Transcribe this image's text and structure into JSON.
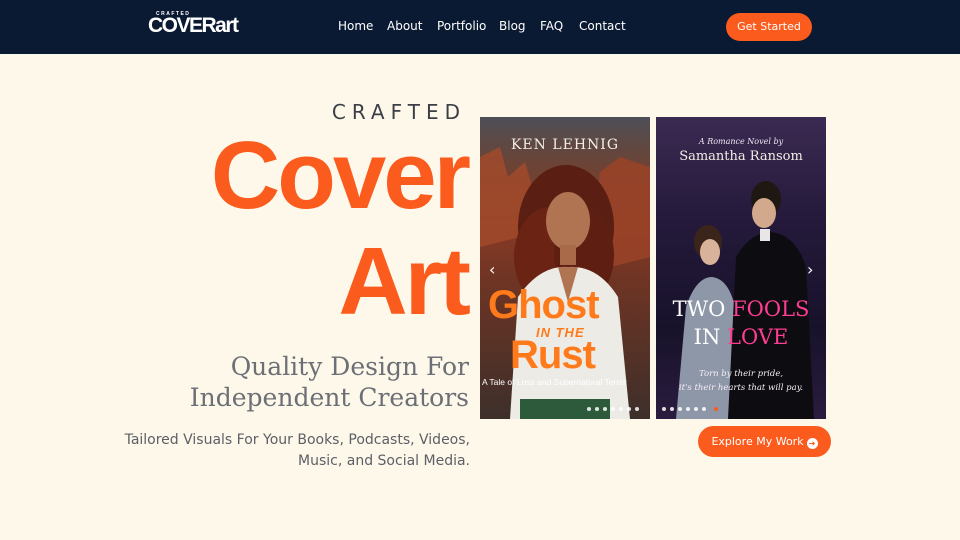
{
  "header": {
    "logo_small": "CRAFTED",
    "logo_big": "COVERart",
    "nav": [
      "Home",
      "About",
      "Portfolio",
      "Blog",
      "FAQ",
      "Contact"
    ],
    "cta": "Get Started"
  },
  "hero": {
    "kicker": "CRAFTED",
    "title_line1": "Cover",
    "title_line2": "Art",
    "tagline_line1": "Quality Design For",
    "tagline_line2": "Independent Creators",
    "subtitle_line1": "Tailored Visuals For Your Books, Podcasts, Videos,",
    "subtitle_line2": "Music, and Social Media.",
    "cta": "Explore My Work",
    "cta_icon": "arrow-right-circle-icon"
  },
  "carousel": {
    "books": [
      {
        "author": "KEN LEHNIG",
        "title_a": "Ghost",
        "title_b": "IN THE",
        "title_c": "Rust",
        "subtitle": "A Tale of Loss and Supernatural Terror"
      },
      {
        "kicker": "A Romance Novel by",
        "author": "Samantha Ransom",
        "title_a": "TWO",
        "title_b": "FOOLS",
        "title_c": "IN",
        "title_d": "LOVE",
        "quote_line1": "Torn by their pride,",
        "quote_line2": "it's their hearts that will pay."
      }
    ],
    "prev_icon": "chevron-left-icon",
    "next_icon": "chevron-right-icon",
    "slide_count": 7,
    "active_slide": 7
  },
  "colors": {
    "accent": "#fb5b1c",
    "nav_bg": "#0b1a33",
    "page_bg": "#fdf8ea",
    "pink": "#ff3d92"
  }
}
